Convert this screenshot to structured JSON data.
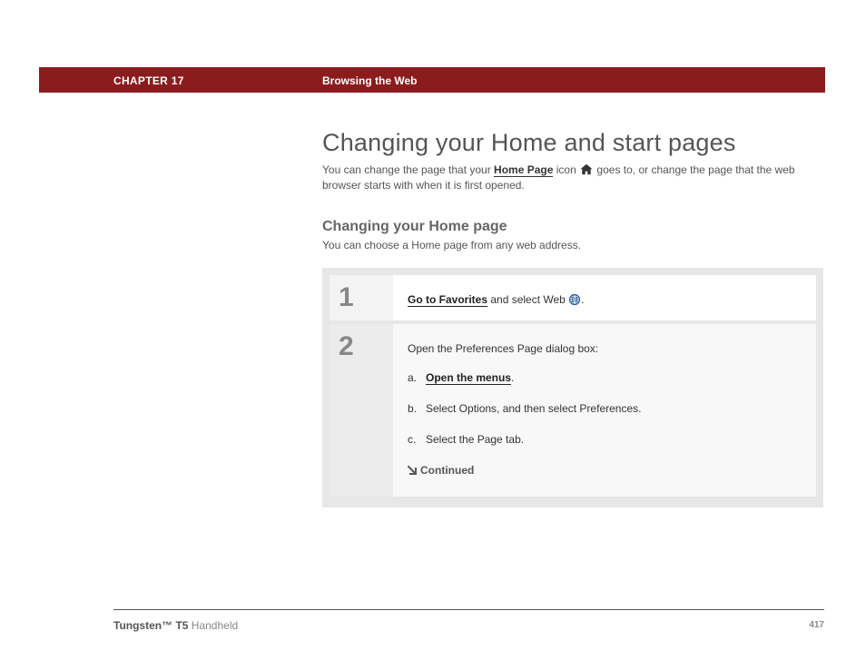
{
  "header": {
    "chapter": "CHAPTER 17",
    "section": "Browsing the Web"
  },
  "title": "Changing your Home and start pages",
  "intro": {
    "pre": "You can change the page that your ",
    "link": "Home Page",
    "mid": " icon ",
    "post": " goes to, or change the page that the web browser starts with when it is first opened."
  },
  "section2": {
    "heading": "Changing your Home page",
    "text": "You can choose a Home page from any web address."
  },
  "steps": [
    {
      "num": "1",
      "link": "Go to Favorites",
      "rest": " and select Web ",
      "tail": "."
    },
    {
      "num": "2",
      "lead": "Open the Preferences Page dialog box:",
      "subs": [
        {
          "letter": "a.",
          "link": "Open the menus",
          "tail": "."
        },
        {
          "letter": "b.",
          "text": "Select Options, and then select Preferences."
        },
        {
          "letter": "c.",
          "text": "Select the Page tab."
        }
      ],
      "continued": "Continued"
    }
  ],
  "footer": {
    "brand": "Tungsten™ T5",
    "suffix": " Handheld",
    "page": "417"
  }
}
